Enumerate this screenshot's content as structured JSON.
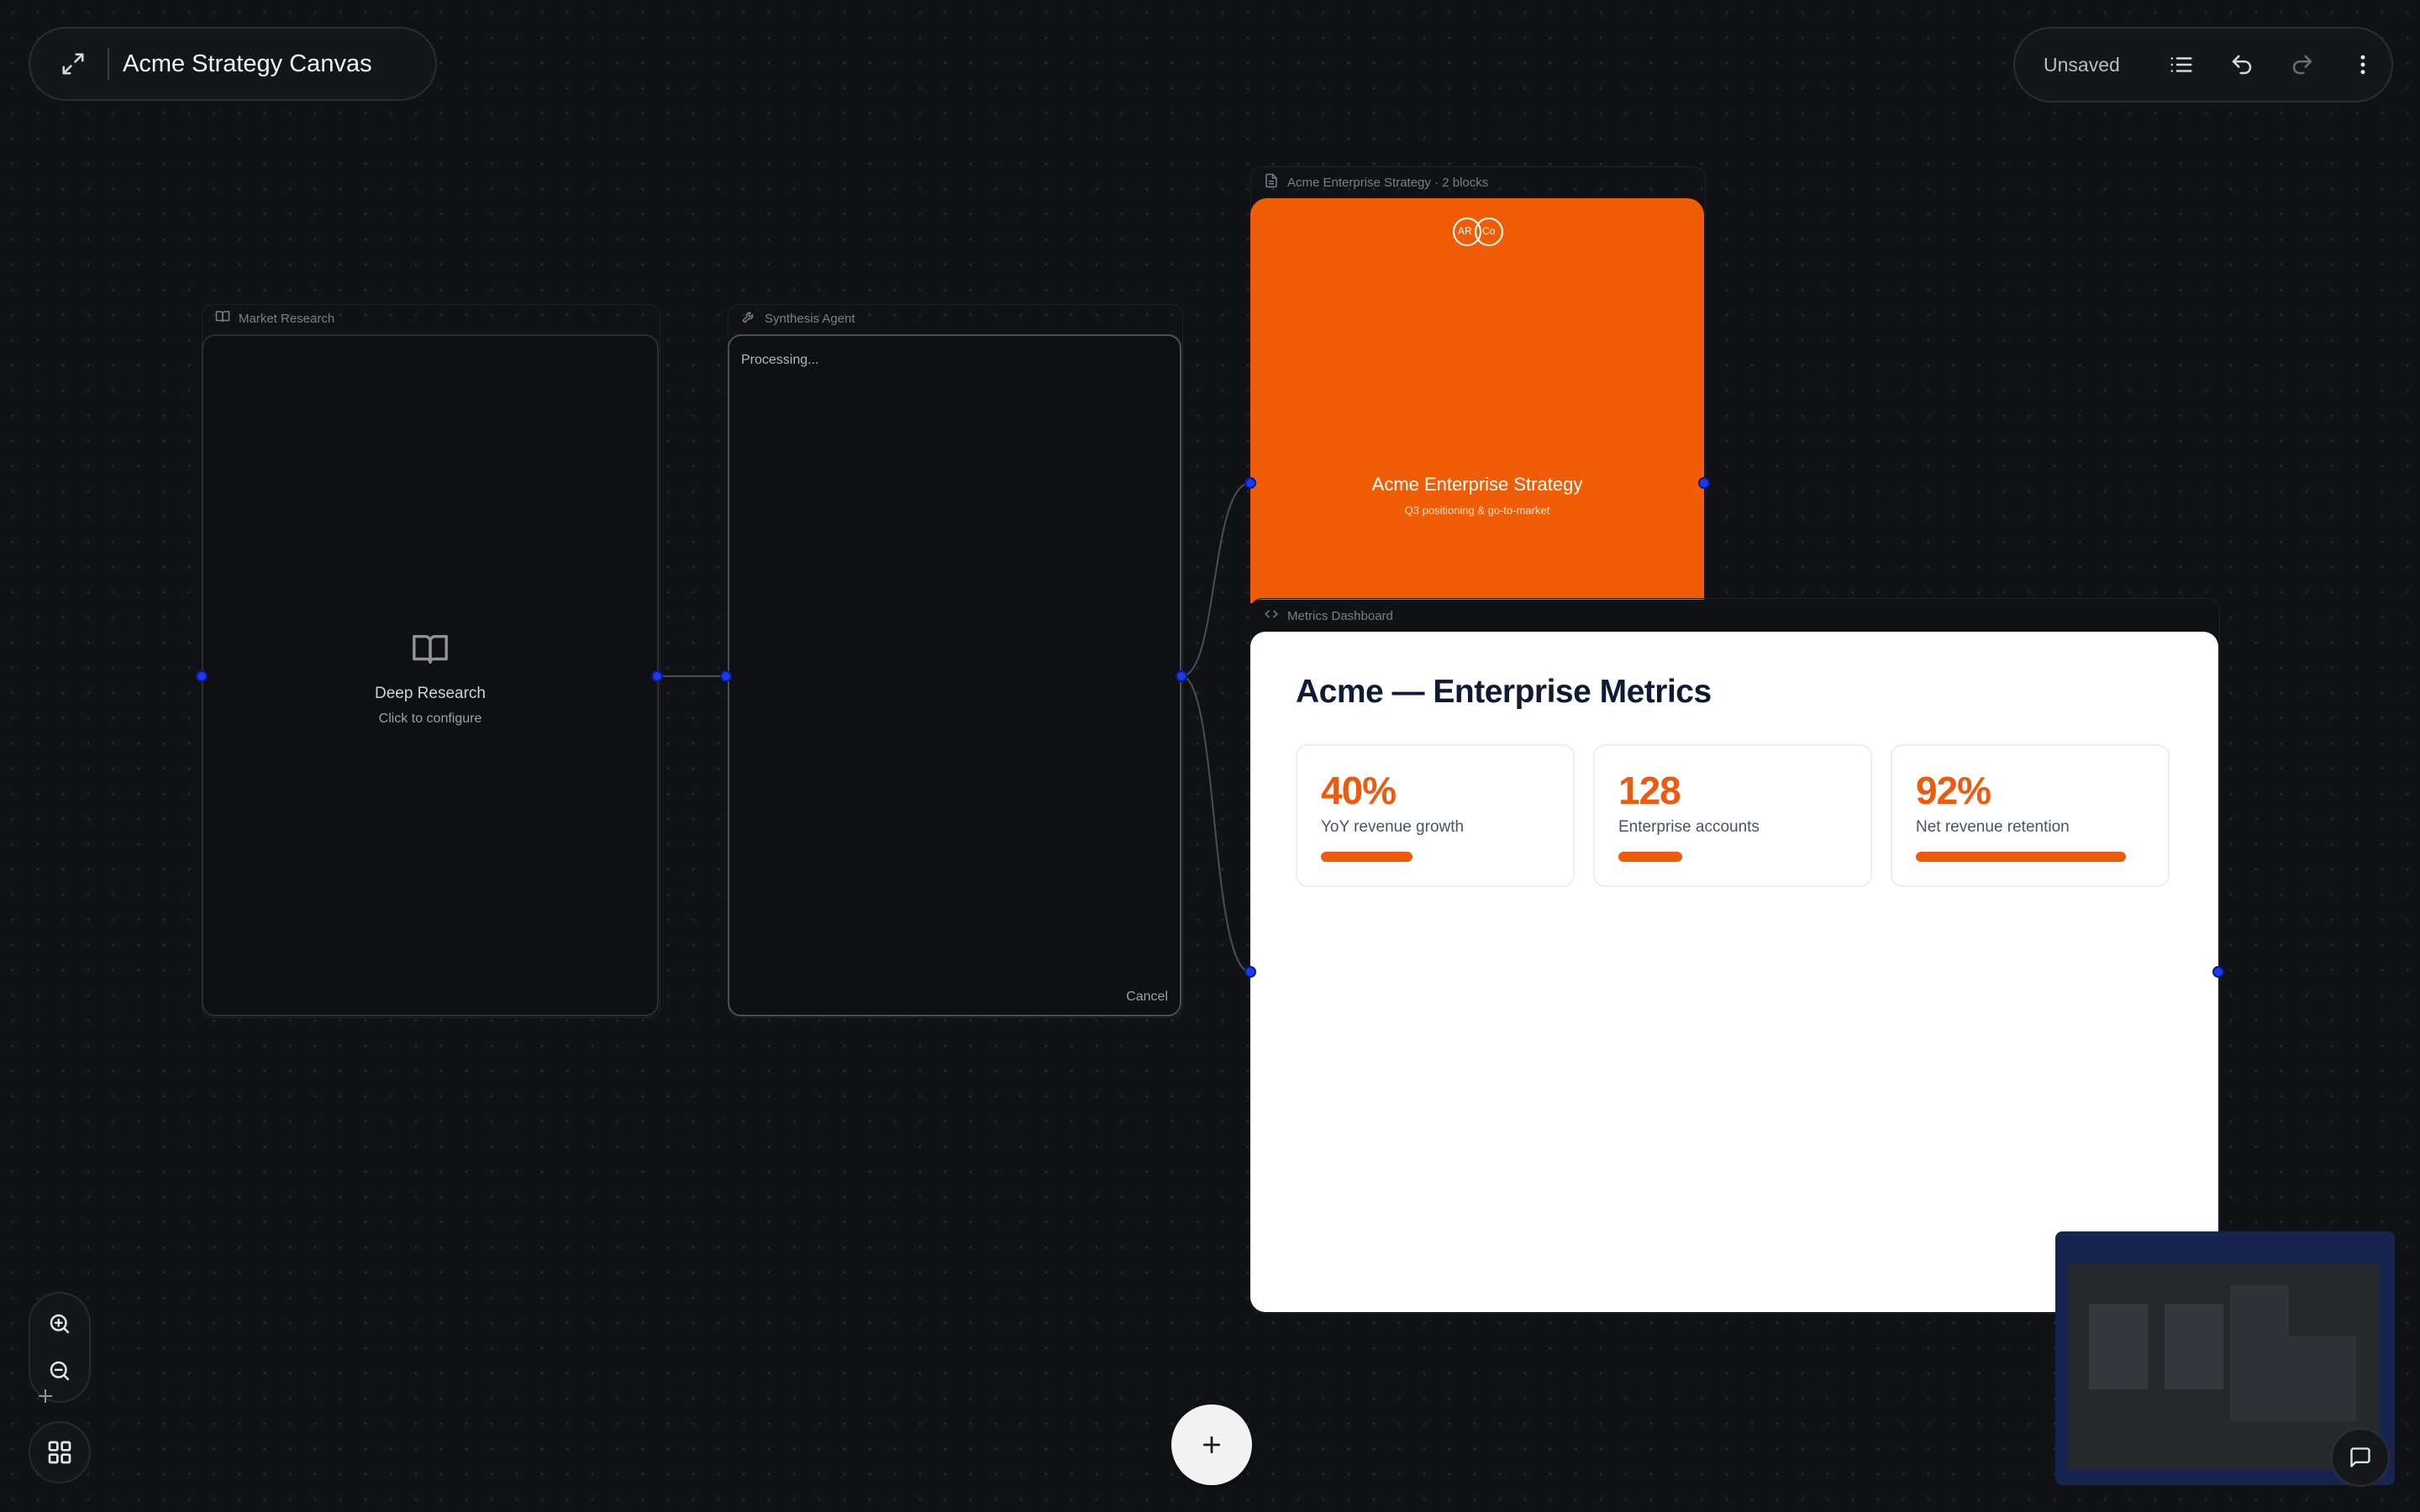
{
  "header": {
    "title": "Acme Strategy Canvas"
  },
  "toolbar": {
    "status": "Unsaved"
  },
  "nodes": {
    "market_research": {
      "label": "Market Research",
      "title": "Deep Research",
      "subtitle": "Click to configure"
    },
    "synthesis_agent": {
      "label": "Synthesis Agent",
      "status": "Processing...",
      "cancel": "Cancel"
    },
    "strategy_doc": {
      "label": "Acme Enterprise Strategy · 2 blocks",
      "logo_left": "AR",
      "logo_right": "Co",
      "title": "Acme Enterprise Strategy",
      "subtitle": "Q3 positioning & go-to-market"
    },
    "metrics_dashboard": {
      "label": "Metrics Dashboard",
      "title": "Acme — Enterprise Metrics",
      "metrics": [
        {
          "value": "40%",
          "label": "YoY revenue growth",
          "fill": 0.4
        },
        {
          "value": "128",
          "label": "Enterprise accounts",
          "fill": 0.28
        },
        {
          "value": "92%",
          "label": "Net revenue retention",
          "fill": 0.92
        }
      ]
    }
  },
  "colors": {
    "accent": "#ef5a0d",
    "handle": "#1c39f0",
    "canvas": "#101215"
  },
  "icons": {
    "expand": "expand-icon",
    "list": "list-icon",
    "undo": "undo-icon",
    "redo": "redo-icon",
    "more": "more-vertical-icon",
    "zoom_in": "zoom-in-icon",
    "zoom_out": "zoom-out-icon",
    "grid": "grid-icon",
    "add": "plus-icon",
    "chat": "chat-icon"
  }
}
